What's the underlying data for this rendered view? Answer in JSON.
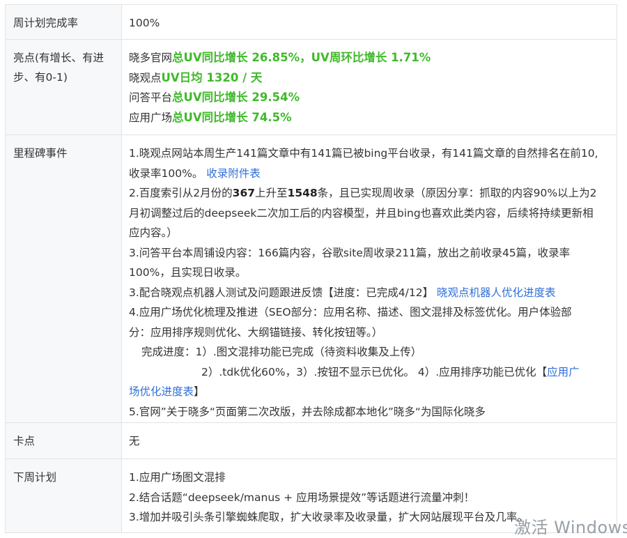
{
  "rows": {
    "rate": {
      "label": "周计划完成率",
      "value": "100%"
    },
    "highlights": {
      "label": "亮点(有增长、有进步、有0-1)",
      "items": [
        {
          "prefix": "晓多官网",
          "metric": "总UV同比增长 26.85%，UV周环比增长 1.71%"
        },
        {
          "prefix": "晓观点",
          "metric": "UV日均 1320 / 天"
        },
        {
          "prefix": "问答平台",
          "metric": "总UV同比增长 29.54%"
        },
        {
          "prefix": "应用广场",
          "metric": "总UV同比增长 74.5%"
        }
      ]
    },
    "milestones": {
      "label": "里程碑事件",
      "m1_line1": "1.晓观点网站本周生产141篇文章中有141篇已被bing平台收录，有141篇文章的自然排名在前10,",
      "m1_line2": "收录率100%。",
      "m1_link": "收录附件表",
      "m2_a": "2.百度索引从2月份的",
      "m2_b": "367",
      "m2_c": "上升至",
      "m2_d": "1548",
      "m2_e": "条，且已实现周收录（原因分享：抓取的内容90%以上为2",
      "m2_line2": "月初调整过后的deepseek二次加工后的内容模型，并且bing也喜欢此类内容，后续将持续更新相",
      "m2_line3": "应内容。）",
      "m3_line1": "3.问答平台本周铺设内容：166篇内容，谷歌site周收录211篇，放出之前收录45篇，收录率",
      "m3_line2": "100%，且实现日收录。",
      "m4_text": "3.配合晓观点机器人测试及问题跟进反馈【进度：已完成4/12】",
      "m4_link": "晓观点机器人优化进度表",
      "m5_line1": "4.应用广场优化梳理及推进（SEO部分：应用名称、描述、图文混排及标签优化。用户体验部",
      "m5_line2": "分：应用排序规则优化、大纲锚链接、转化按钮等。）",
      "m5_line3": "完成进度：1）.图文混排功能已完成（待资料收集及上传）",
      "m5_line4": "2）.tdk优化60%，3）.按钮不显示已优化。 4）.应用排序功能已优化【",
      "m5_link_a": "应用广",
      "m5_link_b": "场优化进度表",
      "m5_end": "】",
      "m6": "5.官网”关于晓多“页面第二次改版，并去除成都本地化”晓多“为国际化晓多"
    },
    "blockers": {
      "label": "卡点",
      "value": "无"
    },
    "next": {
      "label": "下周计划",
      "items": [
        "1.应用广场图文混排",
        "2.结合话题“deepseek/manus + 应用场景提效”等话题进行流量冲刺！",
        "3.增加并吸引头条引擎蜘蛛爬取，扩大收录率及收录量，扩大网站展现平台及几率。"
      ]
    }
  },
  "watermark": "激活 Windows",
  "colors": {
    "highlight_green": "#3fba2a",
    "link_blue": "#2f6fd8",
    "label_bg": "#f7f8fa",
    "border": "#e3e3e3"
  }
}
